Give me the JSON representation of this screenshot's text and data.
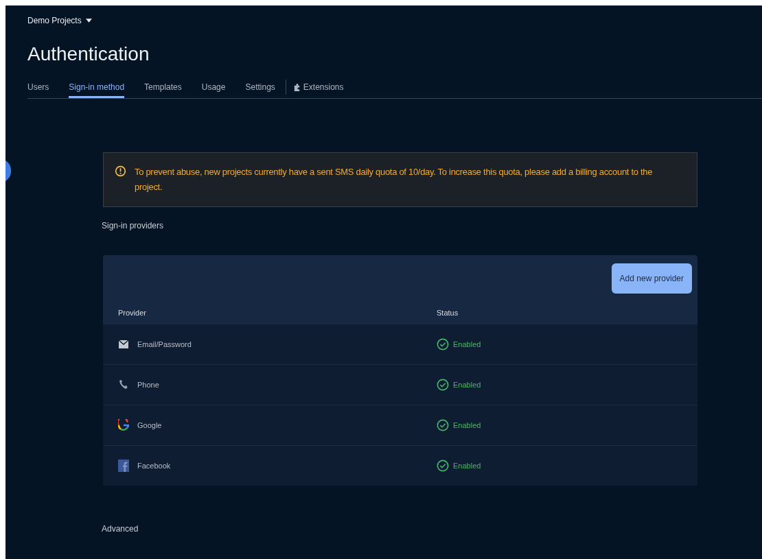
{
  "project_menu": {
    "label": "Demo Projects"
  },
  "title": "Authentication",
  "tabs": [
    {
      "label": "Users",
      "selected": false
    },
    {
      "label": "Sign-in method",
      "selected": true
    },
    {
      "label": "Templates",
      "selected": false
    },
    {
      "label": "Usage",
      "selected": false
    },
    {
      "label": "Settings",
      "selected": false
    },
    {
      "label": "Extensions",
      "selected": false,
      "kind": "extension"
    }
  ],
  "notice": {
    "text": "To prevent abuse, new projects currently have a sent SMS daily quota of 10/day. To increase this quota, please add a billing account to the project."
  },
  "providers_heading": "Sign-in providers",
  "add_button": "Add new provider",
  "table": {
    "columns": [
      "Provider",
      "Status"
    ],
    "rows": [
      {
        "provider": "Email/Password",
        "status": "Enabled",
        "enabled": true
      },
      {
        "provider": "Phone",
        "status": "Enabled",
        "enabled": true
      },
      {
        "provider": "Google",
        "status": "Enabled",
        "enabled": true
      },
      {
        "provider": "Facebook",
        "status": "Enabled",
        "enabled": true
      }
    ]
  },
  "advanced_heading": "Advanced"
}
